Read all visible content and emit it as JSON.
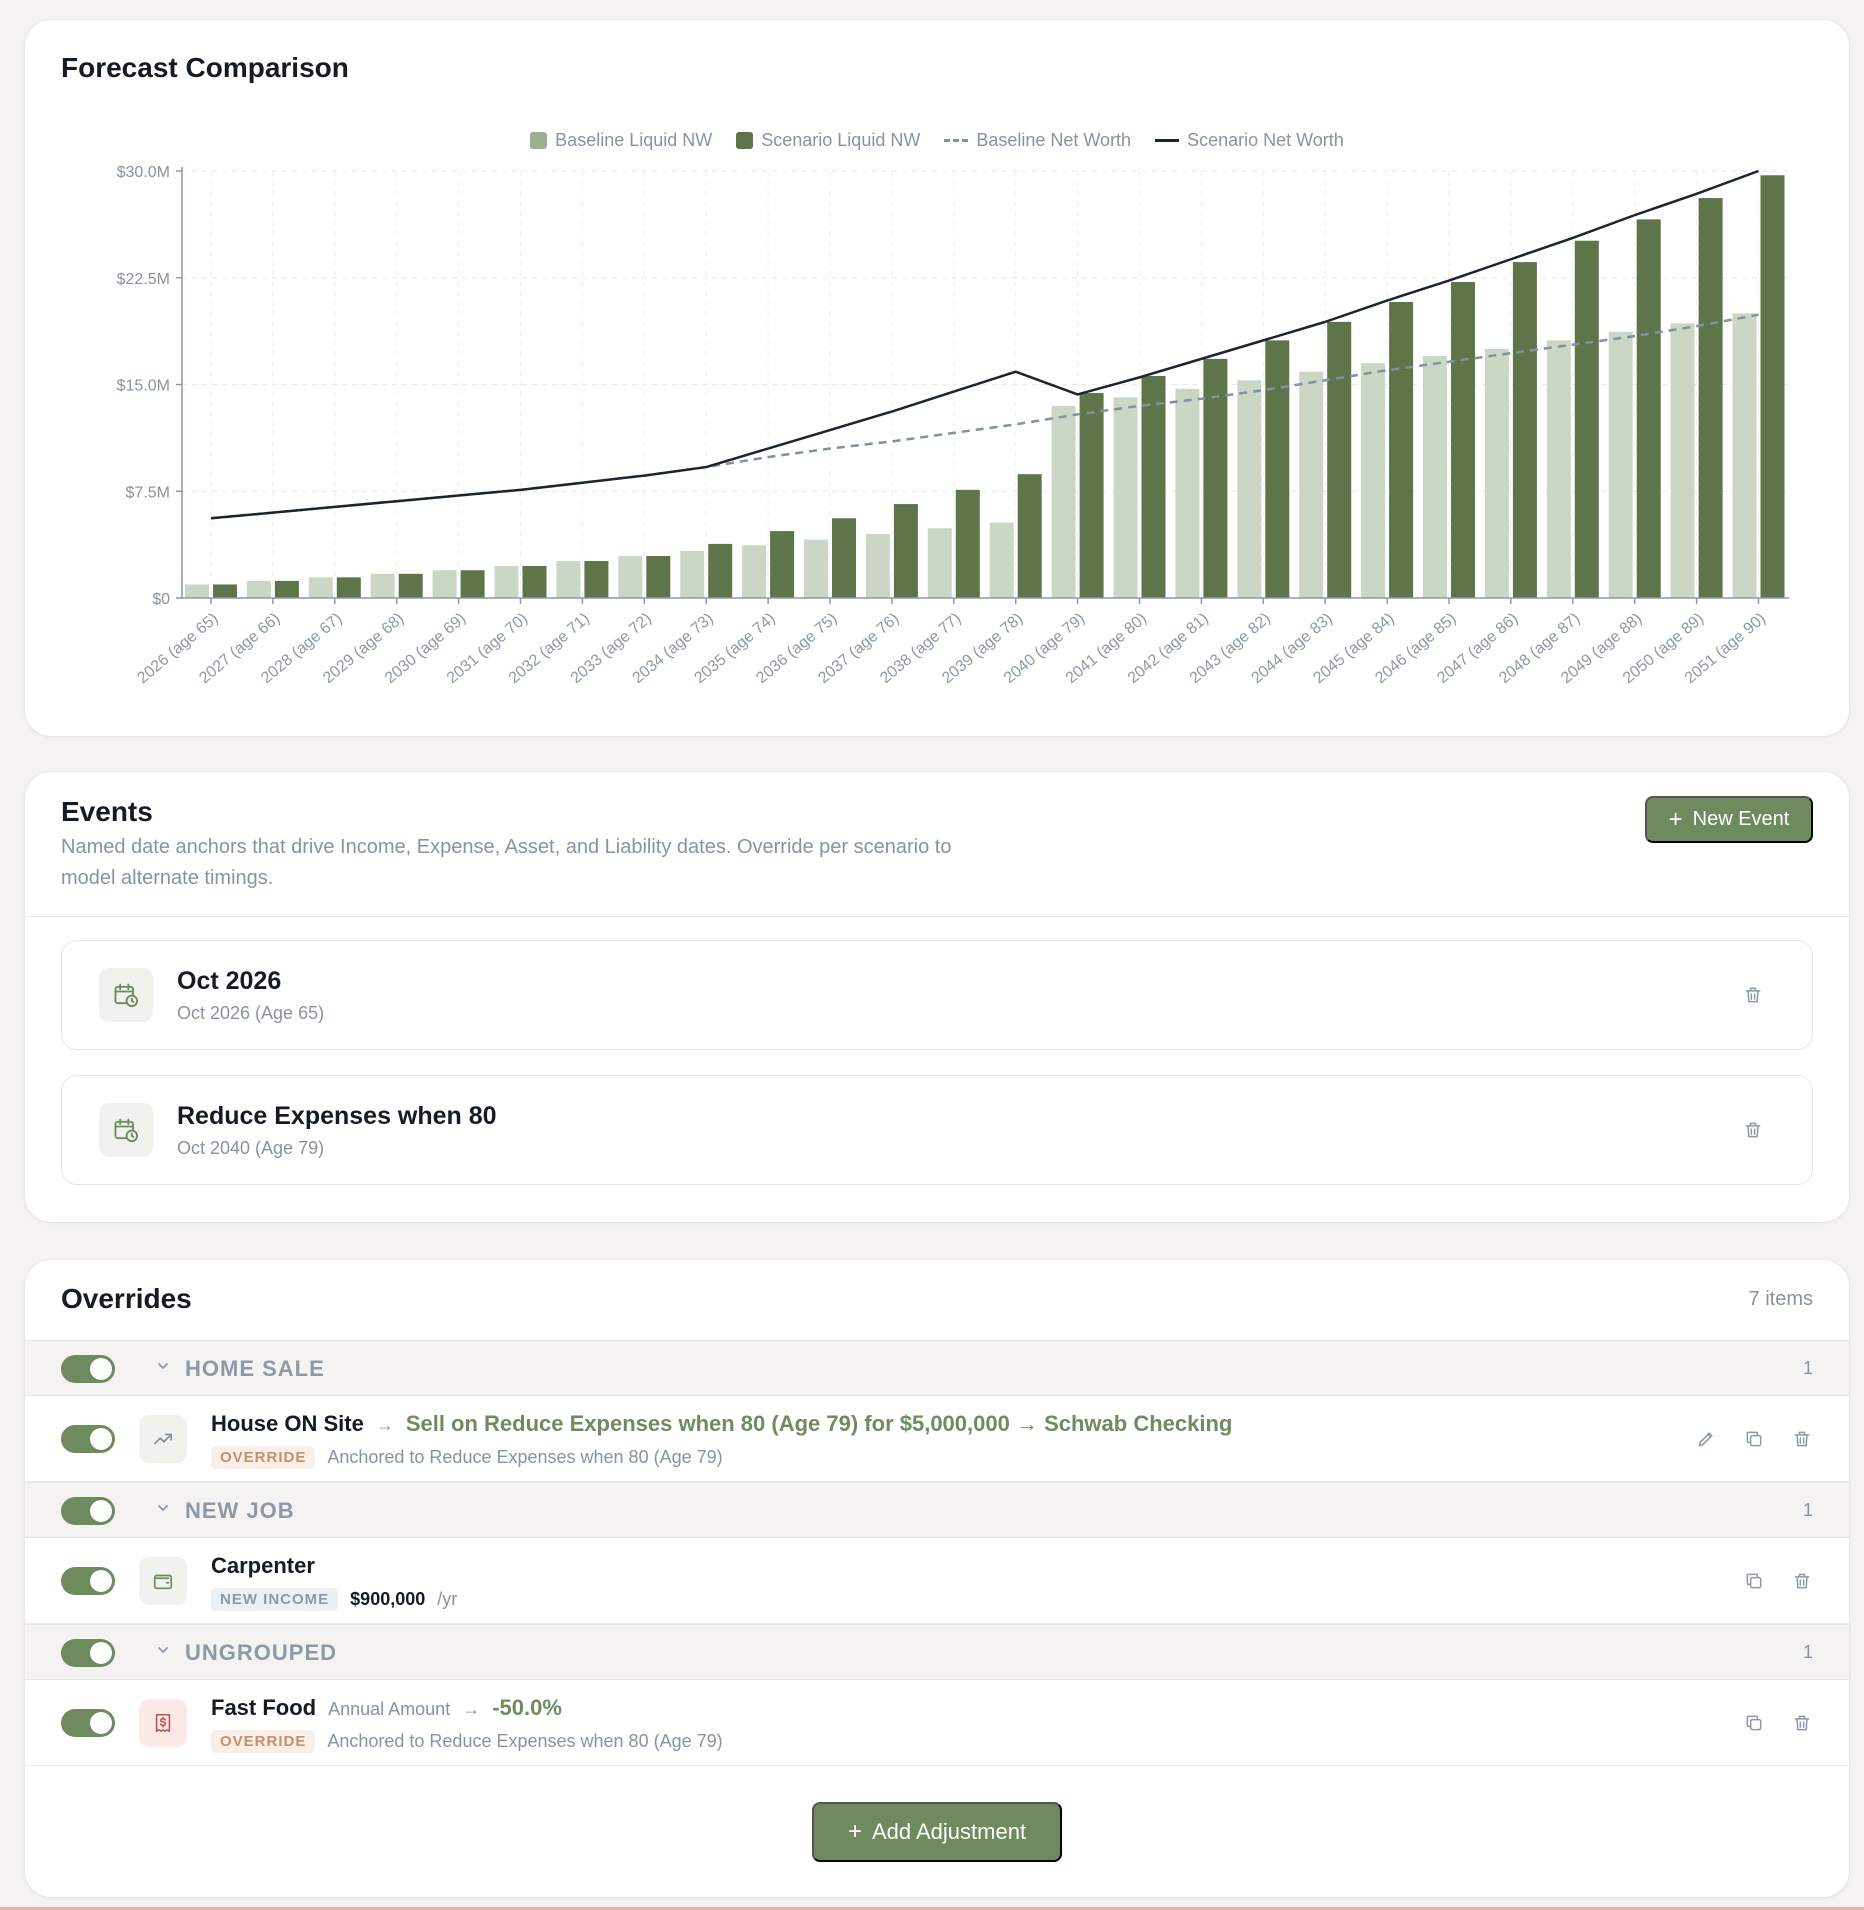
{
  "forecast": {
    "title": "Forecast Comparison",
    "legend": [
      {
        "label": "Baseline Liquid NW",
        "style": "swatch",
        "color": "#9bb08c"
      },
      {
        "label": "Scenario Liquid NW",
        "style": "swatch",
        "color": "#5e7449"
      },
      {
        "label": "Baseline Net Worth",
        "style": "dashed",
        "color": "#7f93a0"
      },
      {
        "label": "Scenario Net Worth",
        "style": "solid",
        "color": "#1c2430"
      }
    ]
  },
  "chart_data": {
    "type": "bar",
    "categories": [
      "2026 (age 65)",
      "2027 (age 66)",
      "2028 (age 67)",
      "2029 (age 68)",
      "2030 (age 69)",
      "2031 (age 70)",
      "2032 (age 71)",
      "2033 (age 72)",
      "2034 (age 73)",
      "2035 (age 74)",
      "2036 (age 75)",
      "2037 (age 76)",
      "2038 (age 77)",
      "2039 (age 78)",
      "2040 (age 79)",
      "2041 (age 80)",
      "2042 (age 81)",
      "2043 (age 82)",
      "2044 (age 83)",
      "2045 (age 84)",
      "2046 (age 85)",
      "2047 (age 86)",
      "2048 (age 87)",
      "2049 (age 88)",
      "2050 (age 89)",
      "2051 (age 90)"
    ],
    "ylim": [
      0,
      30000000
    ],
    "y_ticks": [
      0,
      7500000,
      15000000,
      22500000,
      30000000
    ],
    "y_tick_labels": [
      "$0",
      "$7.5M",
      "$15.0M",
      "$22.5M",
      "$30.0M"
    ],
    "grid": true,
    "legend_position": "top-center",
    "series": [
      {
        "name": "Baseline Liquid NW",
        "kind": "bar",
        "color": "#cbd7c4",
        "values": [
          0.95,
          1.2,
          1.45,
          1.7,
          1.95,
          2.25,
          2.6,
          2.95,
          3.3,
          3.7,
          4.1,
          4.5,
          4.9,
          5.3,
          13.5,
          14.1,
          14.7,
          15.3,
          15.9,
          16.5,
          17.0,
          17.5,
          18.1,
          18.7,
          19.3,
          20.0
        ]
      },
      {
        "name": "Scenario Liquid NW",
        "kind": "bar",
        "color": "#5e7449",
        "values": [
          0.95,
          1.2,
          1.45,
          1.7,
          1.95,
          2.25,
          2.6,
          2.95,
          3.8,
          4.7,
          5.6,
          6.6,
          7.6,
          8.7,
          14.4,
          15.6,
          16.8,
          18.1,
          19.4,
          20.8,
          22.2,
          23.6,
          25.1,
          26.6,
          28.1,
          29.7
        ]
      },
      {
        "name": "Baseline Net Worth",
        "kind": "line",
        "style": "dashed",
        "color": "#7f93a0",
        "values": [
          5.6,
          6.0,
          6.4,
          6.8,
          7.2,
          7.6,
          8.1,
          8.6,
          9.2,
          9.9,
          10.5,
          11.0,
          11.6,
          12.2,
          12.9,
          13.5,
          14.0,
          14.6,
          15.3,
          16.0,
          16.6,
          17.2,
          17.8,
          18.4,
          19.1,
          19.9
        ]
      },
      {
        "name": "Scenario Net Worth",
        "kind": "line",
        "style": "solid",
        "color": "#1c2430",
        "values": [
          5.6,
          6.0,
          6.4,
          6.8,
          7.2,
          7.6,
          8.1,
          8.6,
          9.2,
          10.5,
          11.8,
          13.1,
          14.5,
          15.9,
          14.3,
          15.5,
          16.8,
          18.1,
          19.4,
          20.9,
          22.3,
          23.8,
          25.3,
          26.9,
          28.4,
          30.0
        ]
      }
    ],
    "value_unit": "millions"
  },
  "events": {
    "title": "Events",
    "description": "Named date anchors that drive Income, Expense, Asset, and Liability dates. Override per scenario to model alternate timings.",
    "new_event_label": "New Event",
    "items": [
      {
        "name": "Oct 2026",
        "date": "Oct 2026 (Age 65)",
        "icon": "calendar-clock-icon"
      },
      {
        "name": "Reduce Expenses when 80",
        "date": "Oct 2040 (Age 79)",
        "icon": "calendar-clock-icon"
      }
    ]
  },
  "overrides": {
    "title": "Overrides",
    "count_label": "7 items",
    "add_label": "Add Adjustment",
    "groups": [
      {
        "label": "HOME SALE",
        "count": "1",
        "item": {
          "name": "House ON Site",
          "action": "Sell on Reduce Expenses when 80 (Age 79) for $5,000,000 → Schwab Checking",
          "badge": "OVERRIDE",
          "anchor": "Anchored to Reduce Expenses when 80 (Age 79)",
          "icon": "trending-up-icon"
        }
      },
      {
        "label": "NEW JOB",
        "count": "1",
        "item": {
          "name": "Carpenter",
          "badge": "NEW INCOME",
          "amount": "$900,000",
          "per": "/yr",
          "icon": "wallet-icon"
        }
      },
      {
        "label": "UNGROUPED",
        "count": "1",
        "item": {
          "name": "Fast Food",
          "field": "Annual Amount",
          "pct": "-50.0%",
          "badge": "OVERRIDE",
          "anchor": "Anchored to Reduce Expenses when 80 (Age 79)",
          "icon": "receipt-dollar-icon"
        }
      }
    ]
  },
  "colors": {
    "accent": "#6e8b5f",
    "text": "#141b26",
    "muted": "#8793a3"
  }
}
